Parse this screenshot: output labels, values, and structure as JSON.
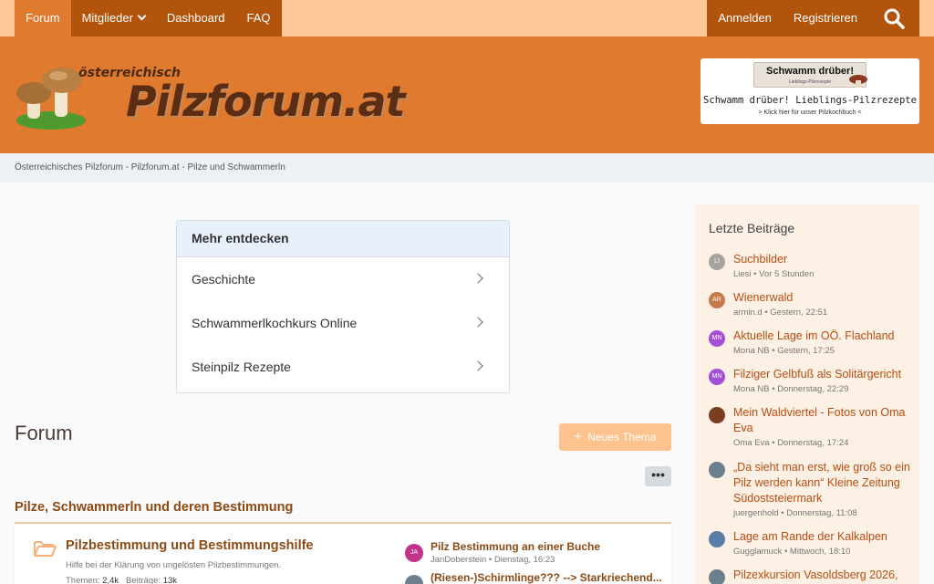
{
  "nav": {
    "forum": "Forum",
    "members": "Mitglieder",
    "dashboard": "Dashboard",
    "faq": "FAQ",
    "login": "Anmelden",
    "register": "Registrieren"
  },
  "logo": {
    "small": "österreichisch",
    "main": "Pilzforum.at"
  },
  "ad": {
    "badge_title": "Schwamm drüber!",
    "badge_sub": "Lieblings-Pilzrezepte",
    "line1": "Schwamm drüber! Lieblings-Pilzrezepte",
    "line2": "> Klick hier für unser Pilzkochbuch <"
  },
  "breadcrumb": "Österreichisches Pilzforum - Pilzforum.at - Pilze und Schwammerln",
  "discover": {
    "heading": "Mehr entdecken",
    "items": [
      "Geschichte",
      "Schwammerlkochkurs Online",
      "Steinpilz Rezepte"
    ]
  },
  "main": {
    "title": "Forum",
    "new_thread": "Neues Thema",
    "more": "•••",
    "category": "Pilze, Schwammerln und deren Bestimmung",
    "node": {
      "title": "Pilzbestimmung und Bestimmungshilfe",
      "description": "Hilfe bei der Klärung von ungelösten Pilzbestimmungen.",
      "threads_label": "Themen:",
      "threads": "2,4k",
      "posts_label": "Beiträge:",
      "posts": "13k",
      "latest": [
        {
          "avatar": "JA",
          "title": "Pilz Bestimmung an einer Buche",
          "meta": "JanDoberstein • Dienstag, 16:23"
        },
        {
          "avatar": "",
          "title": "(Riesen-)Schirmlinge??? --> Starkriechend...",
          "meta": ""
        }
      ]
    }
  },
  "sidebar": {
    "title": "Letzte Beiträge",
    "items": [
      {
        "avatar": "LI",
        "color": "#a9a39d",
        "title": "Suchbilder",
        "meta": "Liesi • Vor 5 Stunden"
      },
      {
        "avatar": "AR",
        "color": "#c8794a",
        "title": "Wienerwald",
        "meta": "armin.d • Gestern, 22:51"
      },
      {
        "avatar": "MN",
        "color": "#a44fd6",
        "title": "Aktuelle Lage im OÖ. Flachland",
        "meta": "Mona NB • Gestern, 17:25"
      },
      {
        "avatar": "MN",
        "color": "#a44fd6",
        "title": "Filziger Gelbfuß als Solitärgericht",
        "meta": "Mona NB • Donnerstag, 22:29"
      },
      {
        "avatar": "",
        "color": "#7a3d22",
        "title": "Mein Waldviertel - Fotos von Oma Eva",
        "meta": "Oma Eva • Donnerstag, 17:24"
      },
      {
        "avatar": "",
        "color": "#6d7f8c",
        "title": "„Da sieht man erst, wie groß so ein Pilz werden kann“ Kleine Zeitung Südoststeiermark",
        "meta": "juergenhold • Donnerstag, 11:08"
      },
      {
        "avatar": "",
        "color": "#5a7da6",
        "title": "Lage am Rande der Kalkalpen",
        "meta": "Gugglamuck • Mittwoch, 18:10"
      },
      {
        "avatar": "",
        "color": "#6d7f8c",
        "title": "Pilzexkursion Vasoldsberg 2026,",
        "meta": ""
      }
    ]
  }
}
